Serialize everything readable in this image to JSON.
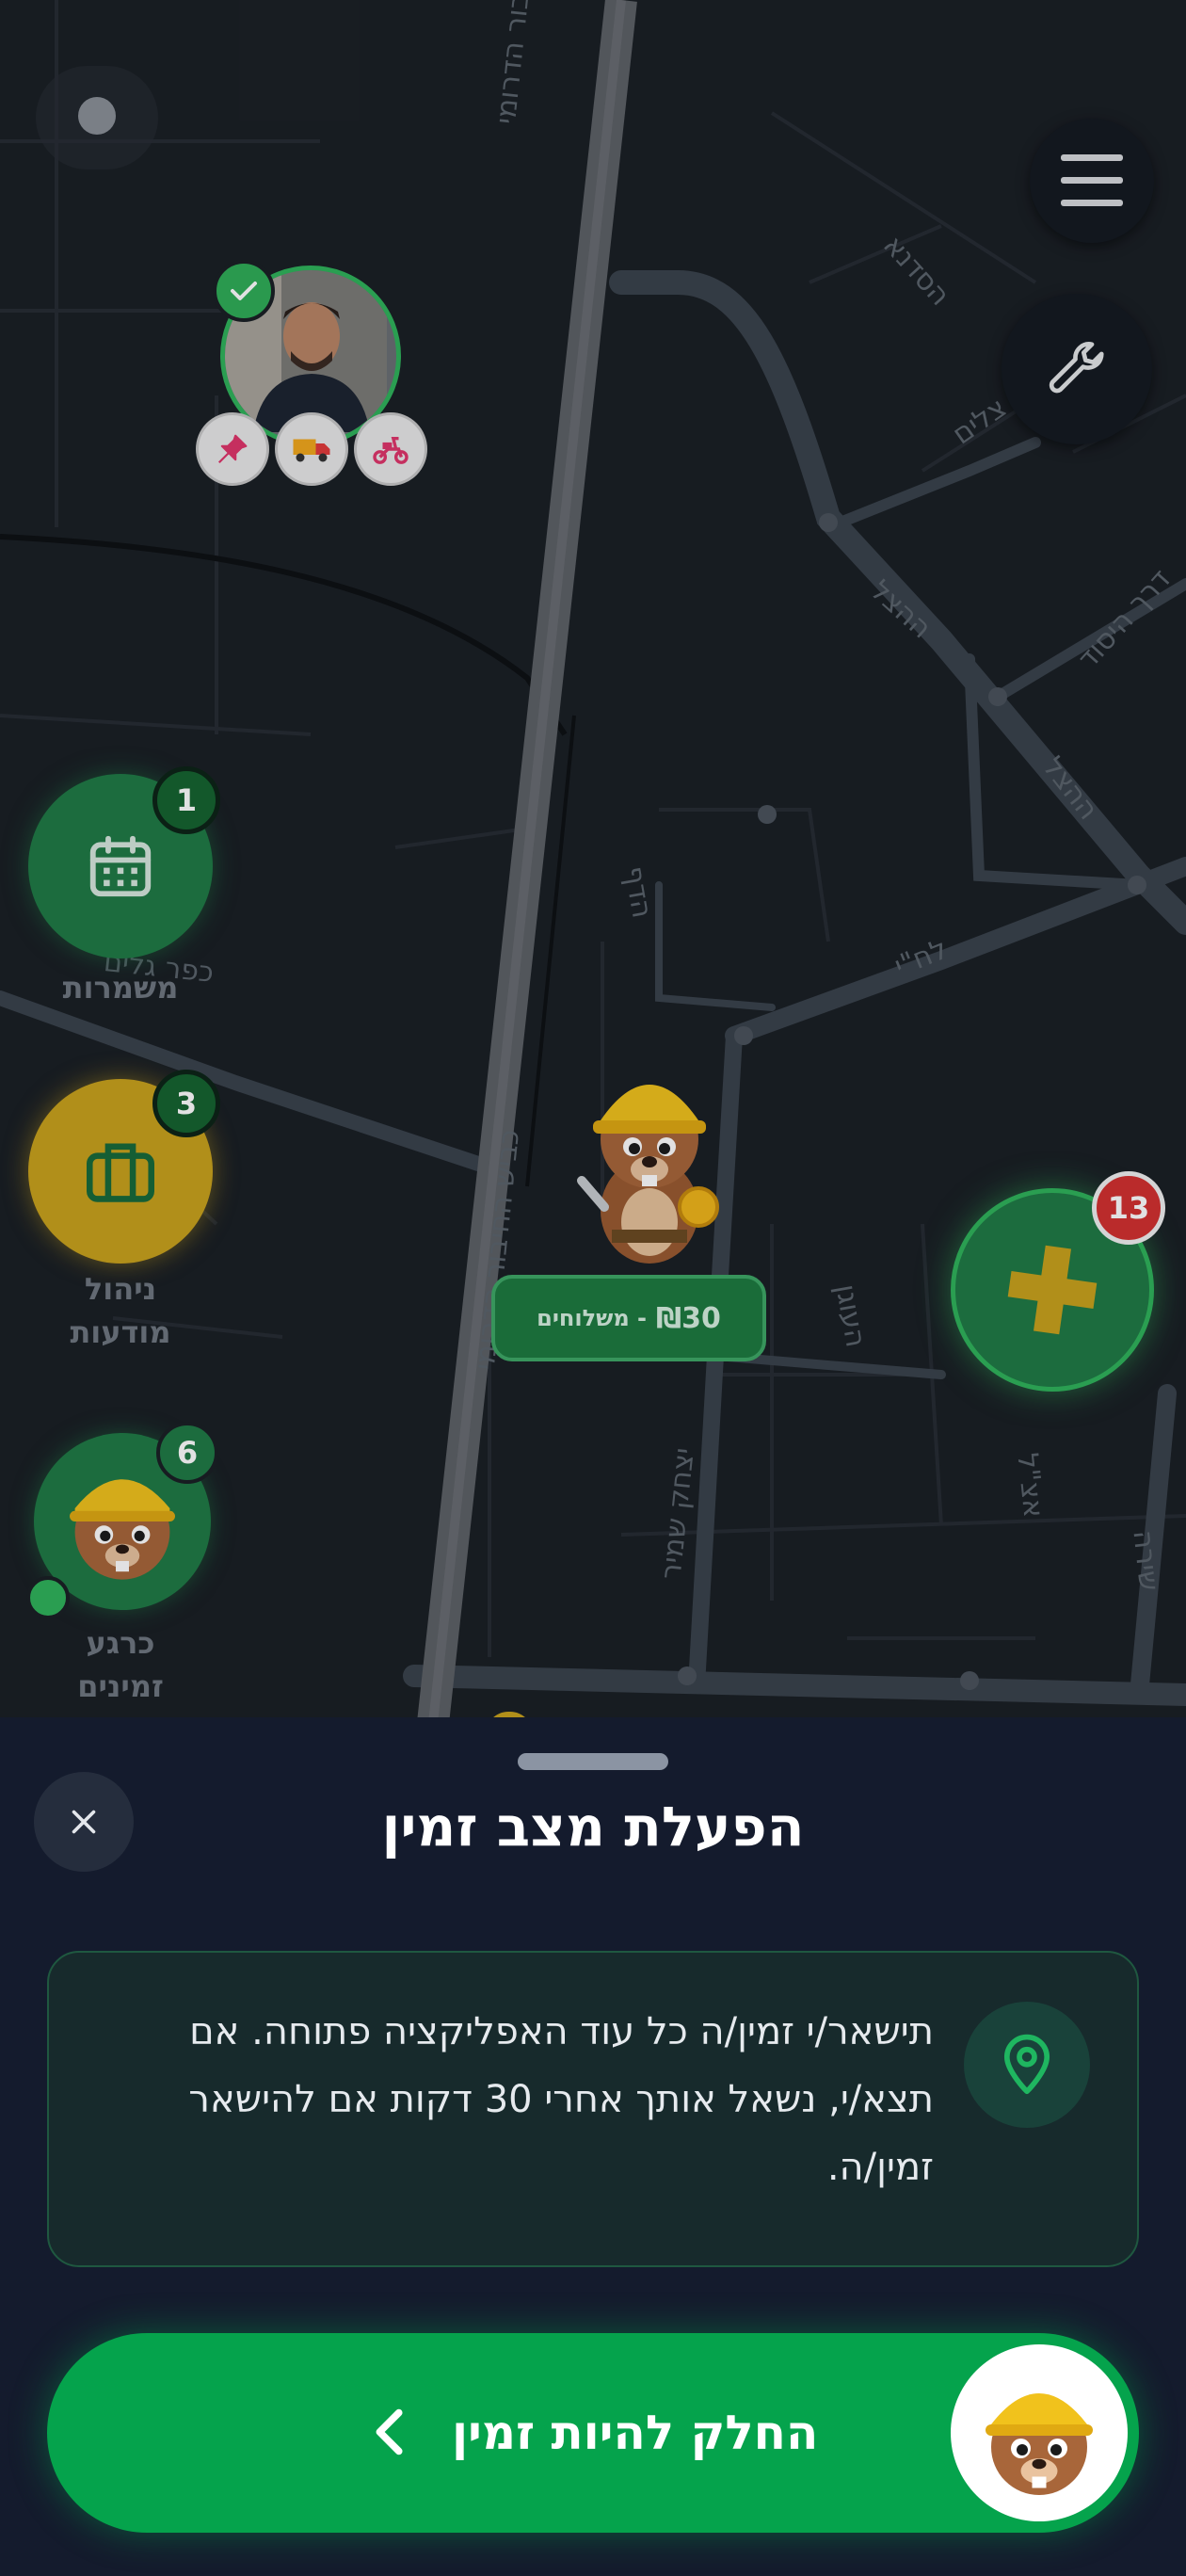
{
  "map": {
    "streets": [
      {
        "id": "haziva-top",
        "name": "כביש החיבור הדרומי"
      },
      {
        "id": "hasadna",
        "name": "הסדנא"
      },
      {
        "id": "hatzalim",
        "name": "צלים"
      },
      {
        "id": "derech-hayesod",
        "name": "דרך היסוד"
      },
      {
        "id": "hahatzel-1",
        "name": "ההצל"
      },
      {
        "id": "hahatzel-2",
        "name": "ההצל"
      },
      {
        "id": "hadaf",
        "name": "הדף"
      },
      {
        "id": "lehi",
        "name": "לח\"י"
      },
      {
        "id": "kfar-galim",
        "name": "כפר גלים"
      },
      {
        "id": "haziva-mid",
        "name": "כביש החיבור הדרומי"
      },
      {
        "id": "haoogen",
        "name": "העוגן"
      },
      {
        "id": "yitzhak-shamir",
        "name": "יצחק שמיר"
      },
      {
        "id": "etzel",
        "name": "אצ\"ל"
      },
      {
        "id": "shira",
        "name": "שירה"
      }
    ]
  },
  "top_controls": {
    "menu_icon": "hamburger-menu-icon",
    "tools_icon": "wrench-icon"
  },
  "profile": {
    "verified_icon": "checkmark-icon",
    "badges": [
      "pin-icon",
      "truck-icon",
      "scooter-icon"
    ]
  },
  "side_actions": [
    {
      "id": "shifts",
      "label": "משמרות",
      "count": "1",
      "icon": "calendar-icon",
      "color": "#1f7a45"
    },
    {
      "id": "ads",
      "label_line1": "ניהול",
      "label_line2": "מודעות",
      "count": "3",
      "icon": "briefcase-icon",
      "color": "#c9a21c"
    },
    {
      "id": "available-now",
      "label_line1": "כרגע",
      "label_line2": "זמינים",
      "count": "6",
      "icon": "beaver-avatar-icon",
      "color": "#1f7a45"
    }
  ],
  "map_markers": {
    "price_amount": "₪30",
    "price_suffix": "- משלוחים",
    "cluster_count": "13",
    "cluster_icon": "plus-cluster-icon"
  },
  "sheet": {
    "title": "הפעלת מצב זמין",
    "info_text": "תישאר/י זמין/ה כל עוד האפליקציה פתוחה. אם תצא/י, נשאל אותך אחרי 30 דקות אם להישאר זמין/ה.",
    "info_icon": "location-pin-icon",
    "close_icon": "close-icon",
    "slide_label": "החלק להיות זמין",
    "slide_icon": "chevron-left-icon",
    "colors": {
      "accent": "#05a34c",
      "sheet_bg": "#141b2d"
    }
  }
}
